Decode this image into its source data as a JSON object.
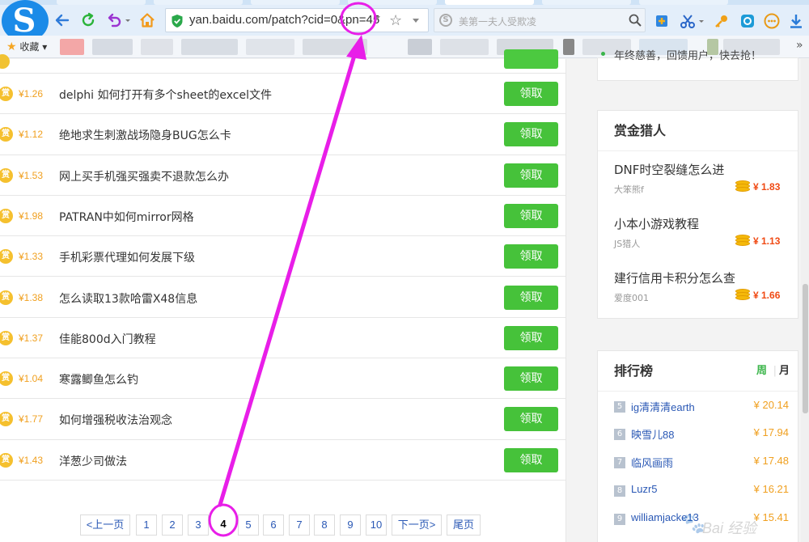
{
  "browser": {
    "url": "yan.baidu.com/patch?cid=0&pn=45",
    "search_placeholder": "美第一夫人受欺凌",
    "favorites_label": "收藏"
  },
  "main": {
    "currency": "¥",
    "coin_label": "赏",
    "claim_label": "领取",
    "rows": [
      {
        "amount": "¥1.26",
        "question": "delphi 如何打开有多个sheet的excel文件"
      },
      {
        "amount": "¥1.12",
        "question": "绝地求生刺激战场隐身BUG怎么卡"
      },
      {
        "amount": "¥1.53",
        "question": "网上买手机强买强卖不退款怎么办"
      },
      {
        "amount": "¥1.98",
        "question": "PATRAN中如何mirror网格"
      },
      {
        "amount": "¥1.33",
        "question": "手机彩票代理如何发展下级"
      },
      {
        "amount": "¥1.38",
        "question": "怎么读取13款哈雷X48信息"
      },
      {
        "amount": "¥1.37",
        "question": "佳能800d入门教程"
      },
      {
        "amount": "¥1.04",
        "question": "寒露鲫鱼怎么钓"
      },
      {
        "amount": "¥1.77",
        "question": "如何增强税收法治观念"
      },
      {
        "amount": "¥1.43",
        "question": "洋葱少司做法"
      }
    ],
    "pager": {
      "prev": "<上一页",
      "pages": [
        "1",
        "2",
        "3",
        "4",
        "5",
        "6",
        "7",
        "8",
        "9",
        "10"
      ],
      "current": "4",
      "next": "下一页>",
      "last": "尾页"
    }
  },
  "sidebar": {
    "top_card_text": "年终慈善，回馈用户，快去抢！",
    "bounty_hunters": {
      "title": "赏金猎人",
      "items": [
        {
          "title": "DNF时空裂缝怎么进",
          "user": "大笨熊f",
          "amount": "¥ 1.83"
        },
        {
          "title": "小本小游戏教程",
          "user": "JS猎人",
          "amount": "¥ 1.13"
        },
        {
          "title": "建行信用卡积分怎么查",
          "user": "爱度001",
          "amount": "¥ 1.66"
        }
      ]
    },
    "ranking": {
      "title": "排行榜",
      "tab_week": "周",
      "tab_month": "月",
      "rows": [
        {
          "rank": "5",
          "name": "ig清清清earth",
          "value": "¥ 20.14"
        },
        {
          "rank": "6",
          "name": "映雪儿88",
          "value": "¥ 17.94"
        },
        {
          "rank": "7",
          "name": "临风画雨",
          "value": "¥ 17.48"
        },
        {
          "rank": "8",
          "name": "Luzr5",
          "value": "¥ 16.21"
        },
        {
          "rank": "9",
          "name": "williamjacke13",
          "value": "¥ 15.41"
        }
      ]
    }
  },
  "watermark": {
    "text": "Bai 经验"
  },
  "colors": {
    "accent_green": "#46c23a",
    "annotation_magenta": "#e81ee8",
    "link_blue": "#2a58b5",
    "amount_orange": "#f0a020",
    "bounty_red": "#f04a14"
  },
  "icons": {
    "back": "back-arrow-icon",
    "refresh": "refresh-icon",
    "undo": "undo-icon",
    "home": "home-icon",
    "shield": "shield-icon",
    "star": "star-icon"
  }
}
